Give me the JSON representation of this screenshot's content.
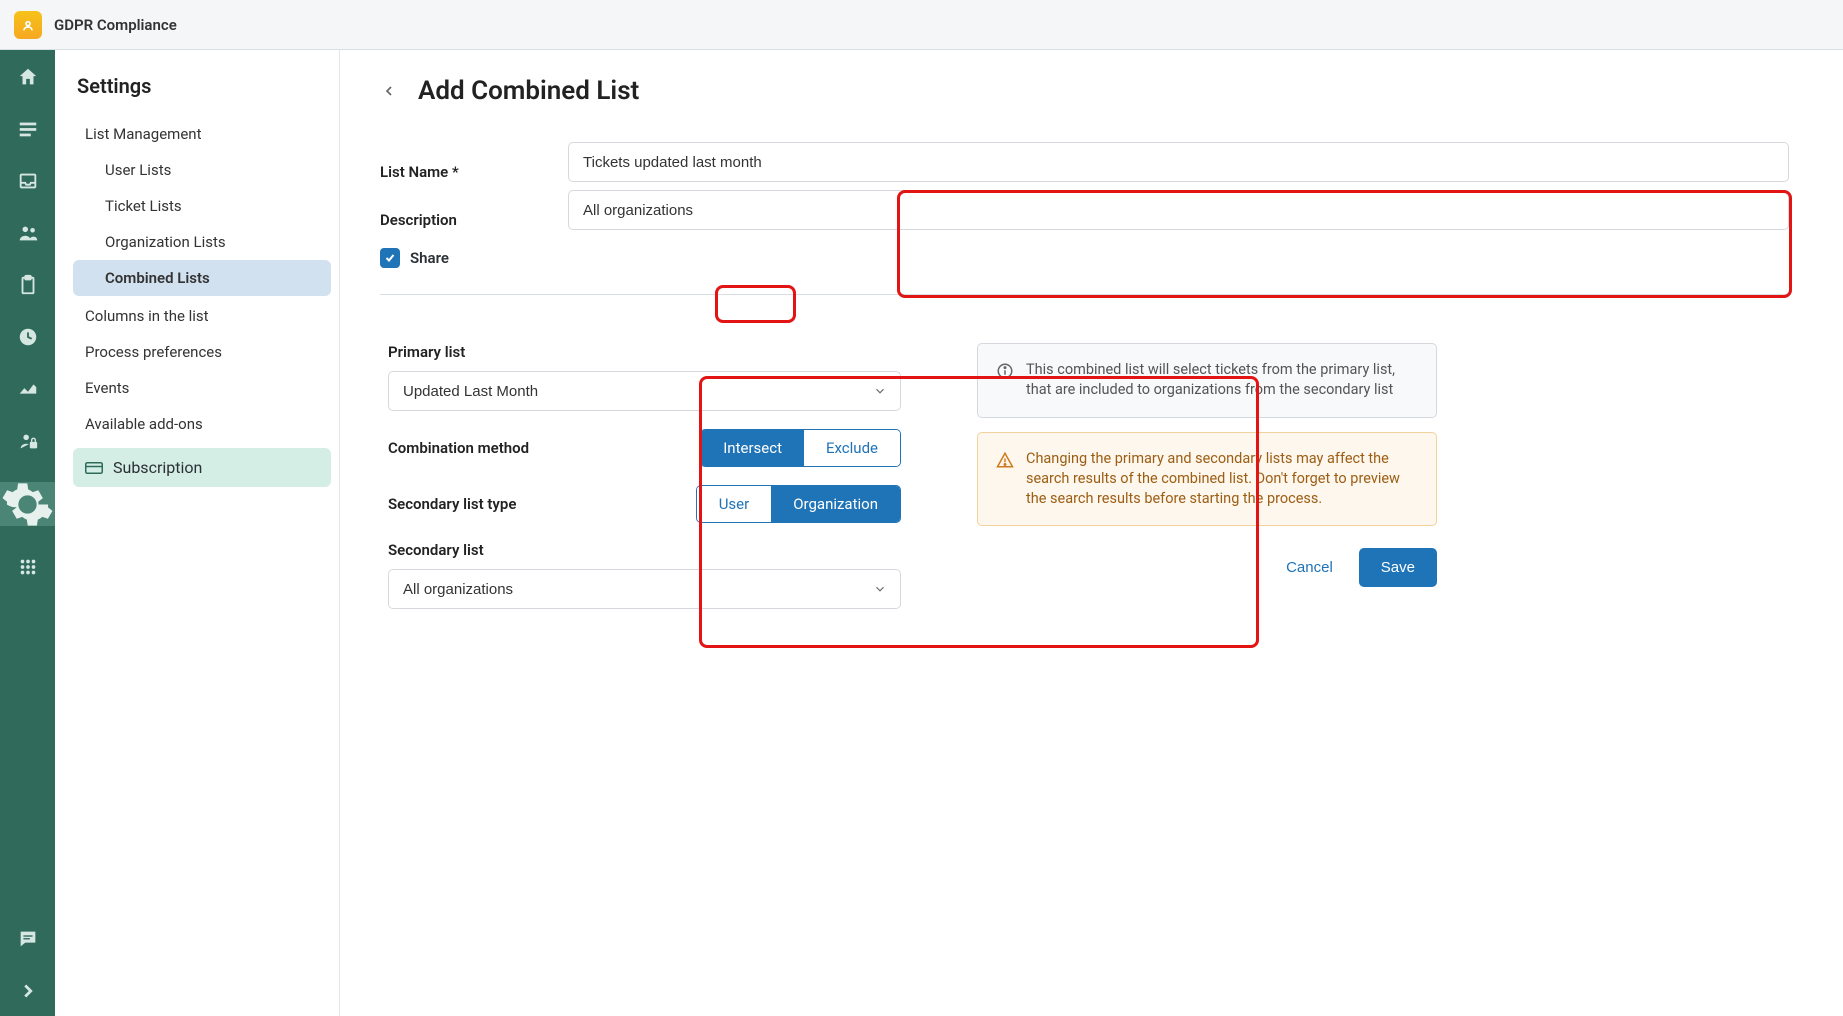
{
  "app": {
    "title": "GDPR Compliance"
  },
  "sidebar": {
    "heading": "Settings",
    "items": {
      "list_management": "List Management",
      "user_lists": "User Lists",
      "ticket_lists": "Ticket Lists",
      "org_lists": "Organization Lists",
      "combined_lists": "Combined Lists",
      "columns": "Columns in the list",
      "process_prefs": "Process preferences",
      "events": "Events",
      "addons": "Available add-ons",
      "subscription": "Subscription"
    }
  },
  "page": {
    "title": "Add Combined List",
    "labels": {
      "list_name": "List Name *",
      "description": "Description",
      "share": "Share",
      "primary_list": "Primary list",
      "combination_method": "Combination method",
      "secondary_list_type": "Secondary list type",
      "secondary_list": "Secondary list"
    },
    "values": {
      "list_name": "Tickets updated last month",
      "description": "All organizations",
      "share_checked": true,
      "primary_list_selected": "Updated Last Month",
      "combination_method_selected": "Intersect",
      "secondary_type_selected": "Organization",
      "secondary_list_selected": "All organizations"
    },
    "toggles": {
      "combination_method": [
        "Intersect",
        "Exclude"
      ],
      "secondary_type": [
        "User",
        "Organization"
      ]
    },
    "info_text": "This combined list will select tickets from the primary list, that are included to organizations from the secondary list",
    "warn_text": "Changing the primary and secondary lists may affect the search results of the combined list. Don't forget to preview the search results before starting the process.",
    "buttons": {
      "cancel": "Cancel",
      "save": "Save"
    }
  }
}
